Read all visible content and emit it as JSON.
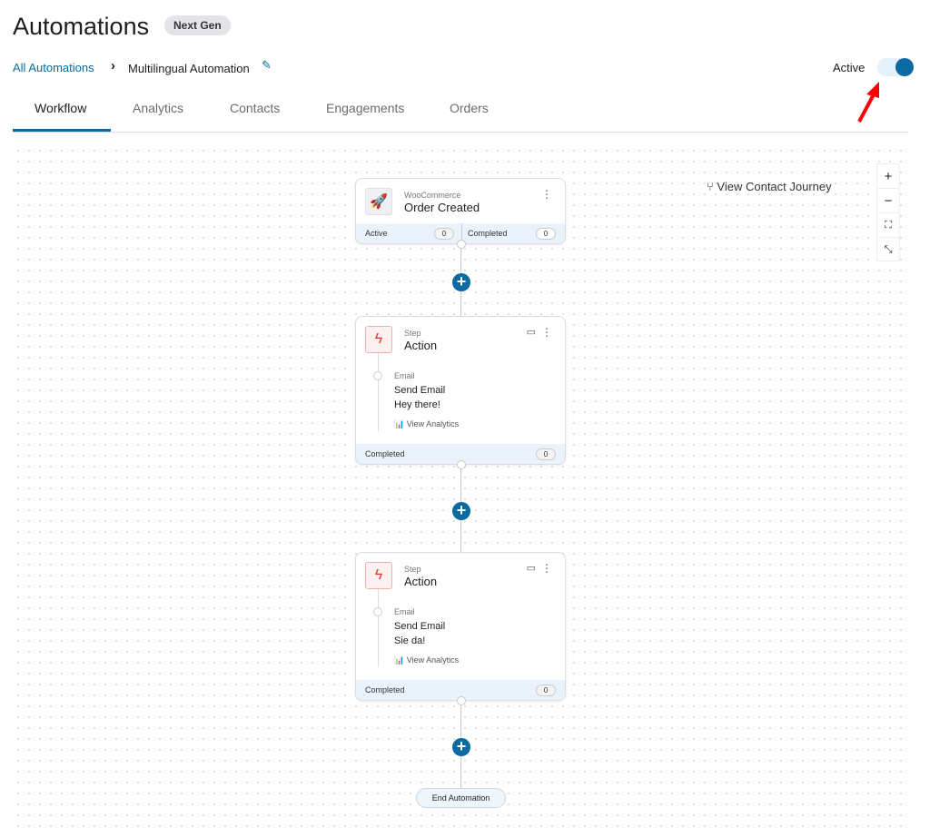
{
  "header": {
    "title": "Automations",
    "badge": "Next Gen",
    "breadcrumb_root": "All Automations",
    "breadcrumb_current": "Multilingual Automation",
    "status_label": "Active",
    "active": true
  },
  "tabs": [
    "Workflow",
    "Analytics",
    "Contacts",
    "Engagements",
    "Orders"
  ],
  "active_tab": "Workflow",
  "canvas": {
    "view_journey": "View Contact Journey",
    "trigger": {
      "source": "WooCommerce",
      "name": "Order Created",
      "active_label": "Active",
      "active_count": "0",
      "completed_label": "Completed",
      "completed_count": "0"
    },
    "steps": [
      {
        "kind": "Step",
        "title": "Action",
        "type": "Email",
        "name": "Send Email",
        "subject": "Hey there!",
        "analytics": "View Analytics",
        "completed_label": "Completed",
        "completed_count": "0"
      },
      {
        "kind": "Step",
        "title": "Action",
        "type": "Email",
        "name": "Send Email",
        "subject": "Sie da!",
        "analytics": "View Analytics",
        "completed_label": "Completed",
        "completed_count": "0"
      }
    ],
    "end_label": "End Automation"
  },
  "colors": {
    "accent": "#0a6aa1",
    "annotation_arrow": "#ff0000"
  }
}
